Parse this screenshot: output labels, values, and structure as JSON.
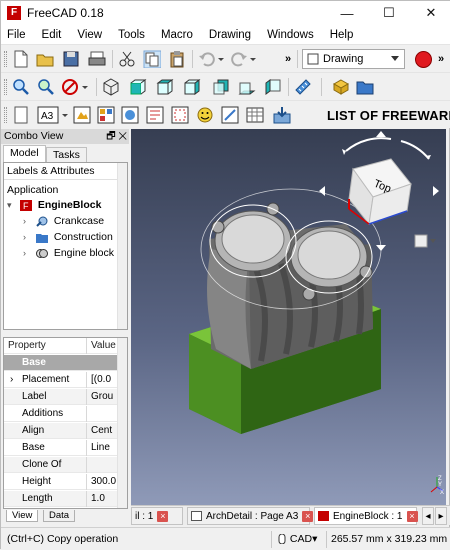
{
  "window": {
    "title": "FreeCAD 0.18",
    "logo_letter": "F",
    "minimize_glyph": "—",
    "maximize_glyph": "☐",
    "close_glyph": "✕"
  },
  "menu": [
    "File",
    "Edit",
    "View",
    "Tools",
    "Macro",
    "Drawing",
    "Windows",
    "Help"
  ],
  "toolbar": {
    "workbench": "Drawing",
    "overflow": "»",
    "watermark": "LIST OF FREEWARE"
  },
  "combo": {
    "title": "Combo View",
    "float_glyph": "🗗",
    "close_glyph": "✕",
    "tabs": [
      "Model",
      "Tasks"
    ],
    "tree_header": "Labels & Attributes",
    "root": "Application",
    "document": "EngineBlock",
    "items": [
      "Crankcase",
      "Construction",
      "Engine block"
    ],
    "bottom_tabs": [
      "View",
      "Data"
    ]
  },
  "properties": {
    "col1": "Property",
    "col2": "Value",
    "group": "Base",
    "rows": [
      {
        "name": "Placement",
        "value": "[(0.0",
        "expander": "›"
      },
      {
        "name": "Label",
        "value": "Grou",
        "expander": ""
      },
      {
        "name": "Additions",
        "value": "",
        "expander": ""
      },
      {
        "name": "Align",
        "value": "Cent",
        "expander": ""
      },
      {
        "name": "Base",
        "value": "Line",
        "expander": ""
      },
      {
        "name": "Clone Of",
        "value": "",
        "expander": ""
      },
      {
        "name": "Height",
        "value": "300.0",
        "expander": ""
      },
      {
        "name": "Length",
        "value": "1.0",
        "expander": ""
      }
    ]
  },
  "view3d": {
    "navcube_face": "Top",
    "axis_labels": [
      "Z",
      "Y",
      "X"
    ]
  },
  "mdi_tabs": [
    {
      "label": "il : 1",
      "active": false,
      "icon": "drawing-page-icon"
    },
    {
      "label": "ArchDetail : Page A3",
      "active": false,
      "icon": "drawing-page-icon"
    },
    {
      "label": "EngineBlock : 1",
      "active": true,
      "icon": "freecad-document-icon"
    }
  ],
  "mdi_nav": [
    "◂",
    "▸"
  ],
  "statusbar": {
    "message": "(Ctrl+C) Copy operation",
    "nav_style": "CAD",
    "dimensions": "265.57 mm x 319.23 mm"
  }
}
